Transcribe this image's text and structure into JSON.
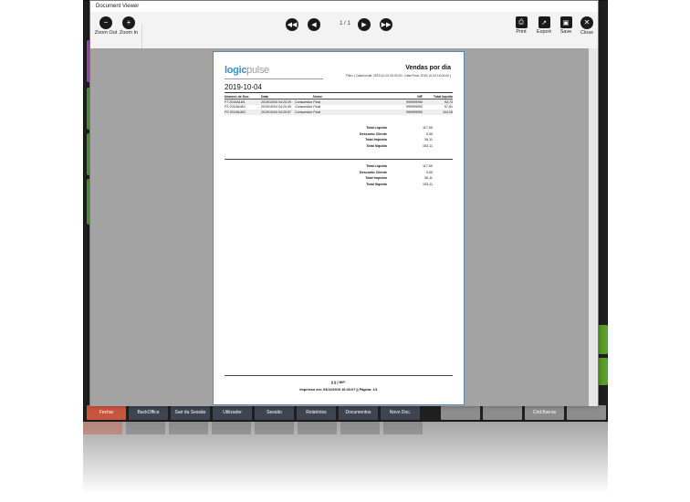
{
  "window": {
    "title": "Document Viewer"
  },
  "toolbar": {
    "zoom_out_label": "Zoom Out",
    "zoom_in_label": "Zoom In",
    "page_indicator": "1 / 1",
    "print_label": "Print",
    "export_label": "Export",
    "save_label": "Save",
    "close_label": "Close"
  },
  "document": {
    "logo_part1": "logic",
    "logo_part2": "pulse",
    "title": "Vendas por dia",
    "filter": "Filtro: [ Data Inicial: 2019-10-01 00:00:00 ; Data Final: 2019-10-04 16:00:00 ]",
    "date": "2019-10-04",
    "columns": [
      "Número de Doc.",
      "Data",
      "Nome",
      "NIF",
      "Total líquido"
    ],
    "rows": [
      [
        "FT 2019A18/1",
        "2019/10/04 04:20:29",
        "Consumidor Final",
        "999999990",
        "93,73"
      ],
      [
        "FS 2019A18/1",
        "2019/10/04 04:20:49",
        "Consumidor Final",
        "999999990",
        "57,81"
      ],
      [
        "FS 2019A18/2",
        "2019/10/04 04:20:57",
        "Consumidor Final",
        "999999990",
        "104,05"
      ]
    ],
    "totals_1": [
      {
        "label": "Total Líquido",
        "value": "117,00"
      },
      {
        "label": "Desconto Cliente",
        "value": "0,00"
      },
      {
        "label": "Total Imposto",
        "value": "36,11"
      },
      {
        "label": "Total Ilíquido",
        "value": "153,11"
      }
    ],
    "totals_2": [
      {
        "label": "Total Líquido",
        "value": "117,00"
      },
      {
        "label": "Desconto Cliente",
        "value": "0,00"
      },
      {
        "label": "Total Imposto",
        "value": "36,11"
      },
      {
        "label": "Total Ilíquido",
        "value": "153,11"
      }
    ],
    "footer_line1": "|| || | NIF:",
    "footer_line2": "Impresso em: 04/10/2019 16:26:07 || Página: 1/1"
  },
  "bottom_bar": {
    "buttons": [
      "Fechar",
      "BackOffice",
      "Sair da Sessão",
      "Utilizador",
      "Sessão",
      "Relatórios",
      "Documentos",
      "Novo Doc.",
      "",
      "",
      "Cód.Barras",
      ""
    ]
  },
  "colors": {
    "accent_blue": "#3a8fc8",
    "pos_green": "#5c9e2c",
    "pos_purple": "#a44bd0",
    "button_red": "#c8553d",
    "button_dark": "#3e4450"
  }
}
